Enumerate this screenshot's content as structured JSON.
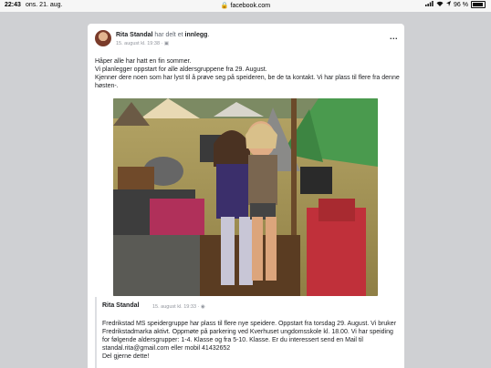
{
  "status_bar": {
    "time": "22:43",
    "date": "ons. 21. aug.",
    "url": "facebook.com",
    "battery": "96 %"
  },
  "post": {
    "author": "Rita Standal",
    "action": "har delt et",
    "action_link": "innlegg",
    "action_end": ".",
    "timestamp": "15. august kl. 19:38",
    "more": "...",
    "text_lines": [
      "Håper alle har hatt en fin sommer.",
      "Vi planlegger oppstart for alle aldersgruppene fra 29. August.",
      "Kjenner dere noen som har lyst til å prøve seg på speideren, be de ta kontakt. Vi har plass til flere fra denne høsten-."
    ]
  },
  "shared_post": {
    "author": "Rita Standal",
    "timestamp": "15. august kl. 19:33",
    "text": "Fredrikstad MS speidergruppe har plass til flere nye speidere. Oppstart fra torsdag 29. August. Vi bruker Fredrikstadmarka aktivt. Oppmøte på parkering ved Kverhuset ungdomsskole kl. 18.00. Vi har speiding for følgende aldersgrupper: 1-4. Klasse og fra 5-10. Klasse. Er du interessert send en Mail til standal.rita@gmail.com eller mobil 41432652",
    "closing": "Del gjerne dette!"
  },
  "colors": {
    "background": "#cfd0d3",
    "card": "#ffffff",
    "meta_text": "#90949c",
    "tent_green": "#4a9a4e"
  }
}
